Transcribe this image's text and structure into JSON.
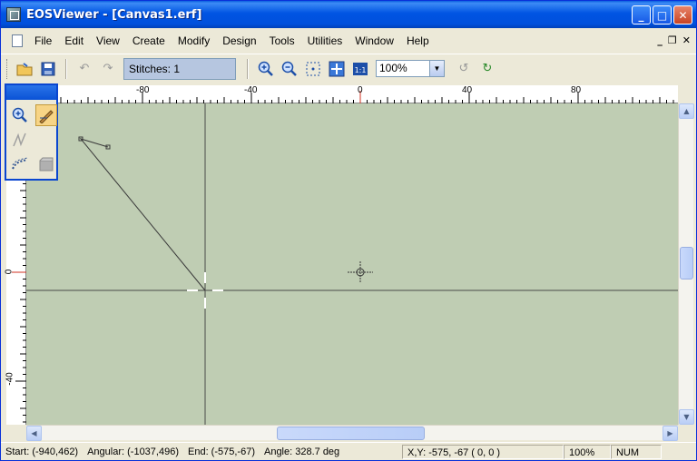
{
  "window": {
    "title": "EOSViewer - [Canvas1.erf]"
  },
  "menu": [
    {
      "label": "File",
      "name": "menu-file"
    },
    {
      "label": "Edit",
      "name": "menu-edit"
    },
    {
      "label": "View",
      "name": "menu-view"
    },
    {
      "label": "Create",
      "name": "menu-create"
    },
    {
      "label": "Modify",
      "name": "menu-modify"
    },
    {
      "label": "Design",
      "name": "menu-design"
    },
    {
      "label": "Tools",
      "name": "menu-tools"
    },
    {
      "label": "Utilities",
      "name": "menu-utilities"
    },
    {
      "label": "Window",
      "name": "menu-window"
    },
    {
      "label": "Help",
      "name": "menu-help"
    }
  ],
  "toolbar": {
    "stitches": "Stitches: 1",
    "zoom": "100%"
  },
  "ruler": {
    "h_labels": [
      "-80",
      "-40",
      "0",
      "40",
      "80"
    ],
    "v_labels": [
      "0",
      "-40"
    ]
  },
  "status": {
    "start": "Start: (-940,462)",
    "angular": "Angular: (-1037,496)",
    "end": "End: (-575,-67)",
    "angle": "Angle: 328.7 deg",
    "xy": "X,Y: -575, -67  ( 0, 0 )",
    "zoom": "100%",
    "num": "NUM"
  },
  "colors": {
    "canvas": "#bfcdb3",
    "titlebar": "#0054e3"
  }
}
